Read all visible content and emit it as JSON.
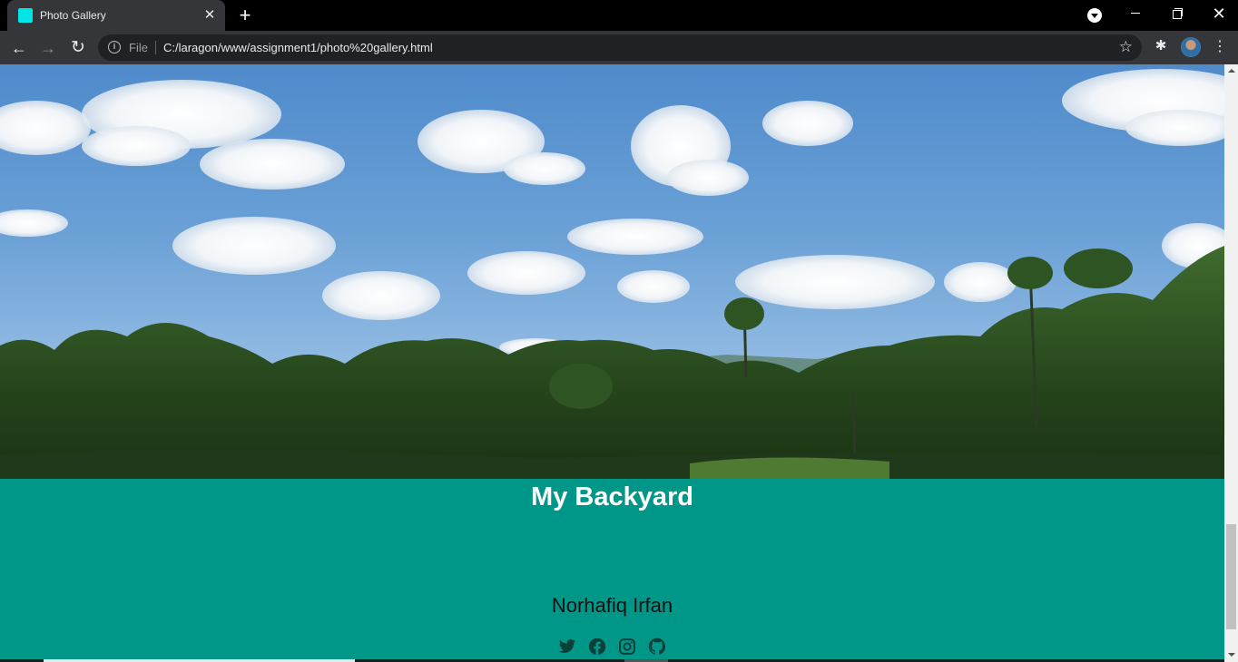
{
  "browser": {
    "tab": {
      "title": "Photo Gallery",
      "close_glyph": "✕",
      "favicon_color": "#00e5e5"
    },
    "new_tab_glyph": "+",
    "window_controls": {
      "close_glyph": "✕"
    },
    "toolbar": {
      "back_glyph": "←",
      "forward_glyph": "→",
      "reload_glyph": "↻",
      "info_glyph": "i",
      "scheme_label": "File",
      "url": "C:/laragon/www/assignment1/photo%20gallery.html",
      "star_glyph": "☆",
      "extensions_glyph": "✱",
      "menu_glyph": "⋮"
    }
  },
  "page": {
    "photo_alt": "My Backyard",
    "caption": "My Backyard",
    "author": "Norhafiq Irfan",
    "socials": [
      {
        "icon": "twitter-icon"
      },
      {
        "icon": "facebook-icon"
      },
      {
        "icon": "instagram-icon"
      },
      {
        "icon": "github-icon"
      }
    ],
    "colors": {
      "band": "#009688",
      "caption_text": "#ffffff",
      "author_text": "#101010",
      "social_icon": "#0b3f3a"
    }
  }
}
